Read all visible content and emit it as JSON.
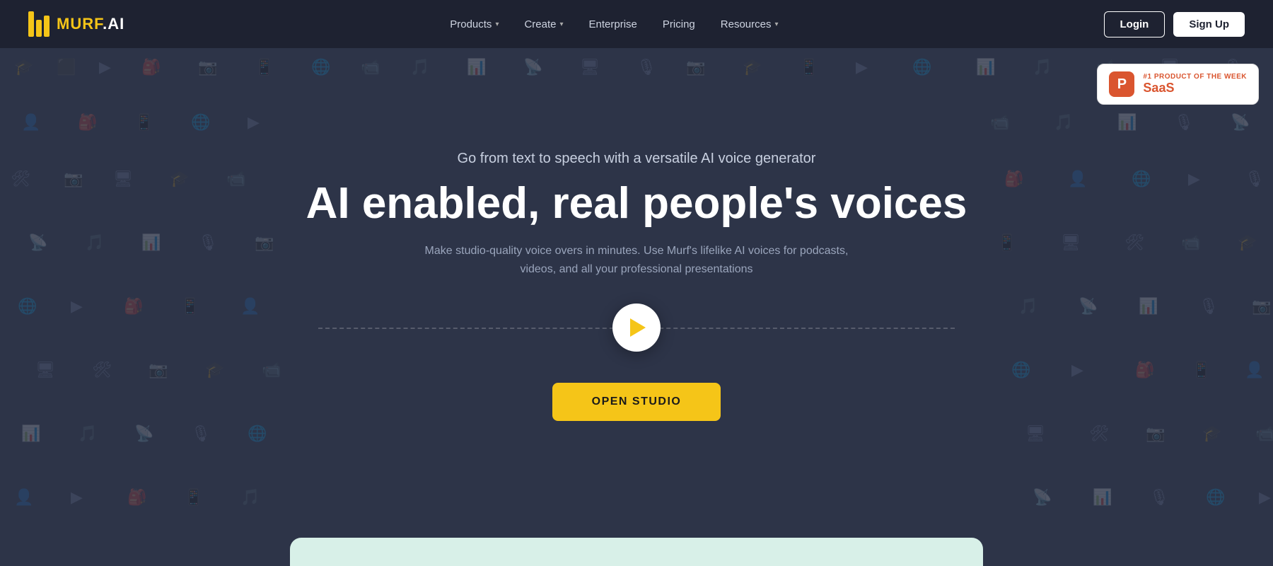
{
  "logo": {
    "text_murf": "MURF",
    "text_ai": ".AI"
  },
  "navbar": {
    "items": [
      {
        "id": "products",
        "label": "Products",
        "has_dropdown": true
      },
      {
        "id": "create",
        "label": "Create",
        "has_dropdown": true
      },
      {
        "id": "enterprise",
        "label": "Enterprise",
        "has_dropdown": false
      },
      {
        "id": "pricing",
        "label": "Pricing",
        "has_dropdown": false
      },
      {
        "id": "resources",
        "label": "Resources",
        "has_dropdown": true
      }
    ],
    "login_label": "Login",
    "signup_label": "Sign Up"
  },
  "hero": {
    "subtitle": "Go from text to speech with a versatile AI voice generator",
    "title": "AI enabled, real people's voices",
    "description": "Make studio-quality voice overs in minutes. Use Murf's lifelike AI voices for podcasts, videos, and all your professional presentations",
    "cta_label": "OPEN STUDIO"
  },
  "product_hunt": {
    "label": "#1 PRODUCT OF THE WEEK",
    "product": "SaaS"
  },
  "colors": {
    "accent": "#f5c518",
    "bg_dark": "#2d3448",
    "navbar_bg": "#1e2231",
    "ph_red": "#da552f"
  }
}
